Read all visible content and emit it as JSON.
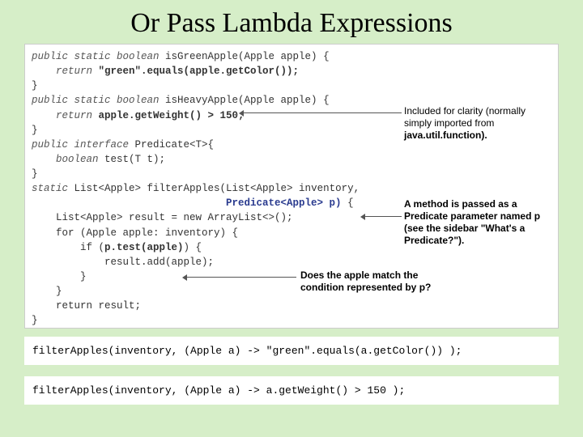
{
  "title": "Or Pass Lambda Expressions",
  "code": {
    "l1a": "public static boolean ",
    "l1b": "isGreenApple(Apple apple)",
    "l1c": " {",
    "l2a": "    return ",
    "l2b": "\"green\".equals(apple.getColor());",
    "l3": "}",
    "l4a": "public static boolean ",
    "l4b": "isHeavyApple(Apple apple)",
    "l4c": " {",
    "l5a": "    return ",
    "l5b": "apple.getWeight() > 150;",
    "l6": "}",
    "l7a": "public interface ",
    "l7b": "Predicate<T>",
    "l7c": "{",
    "l8a": "    boolean ",
    "l8b": "test(T t);",
    "l9": "}",
    "l10a": "static ",
    "l10b": "List<Apple> filterApples(List<Apple> inventory,",
    "l11": "                                Predicate<Apple> p)",
    "l11b": " {",
    "l12": "    List<Apple> result = new ArrayList<>();",
    "l13": "    for (Apple apple: inventory) {",
    "l14a": "        if (",
    "l14b": "p.test(apple)",
    "l14c": ") {",
    "l15": "            result.add(apple);",
    "l16": "        }",
    "l17": "    }",
    "l18": "    return result;",
    "l19": "}"
  },
  "notes": {
    "n1_line1": "Included for clarity (normally",
    "n1_line2": "simply imported from",
    "n1_line3": "java.util.function).",
    "n2": "A method is passed as a Predicate parameter named p (see the sidebar \"What's a Predicate?\").",
    "n3": "Does the apple match the condition represented by p?"
  },
  "examples": {
    "ex1": "filterApples(inventory, (Apple a) -> \"green\".equals(a.getColor()) );",
    "ex2": "filterApples(inventory, (Apple a) -> a.getWeight() > 150 );"
  }
}
